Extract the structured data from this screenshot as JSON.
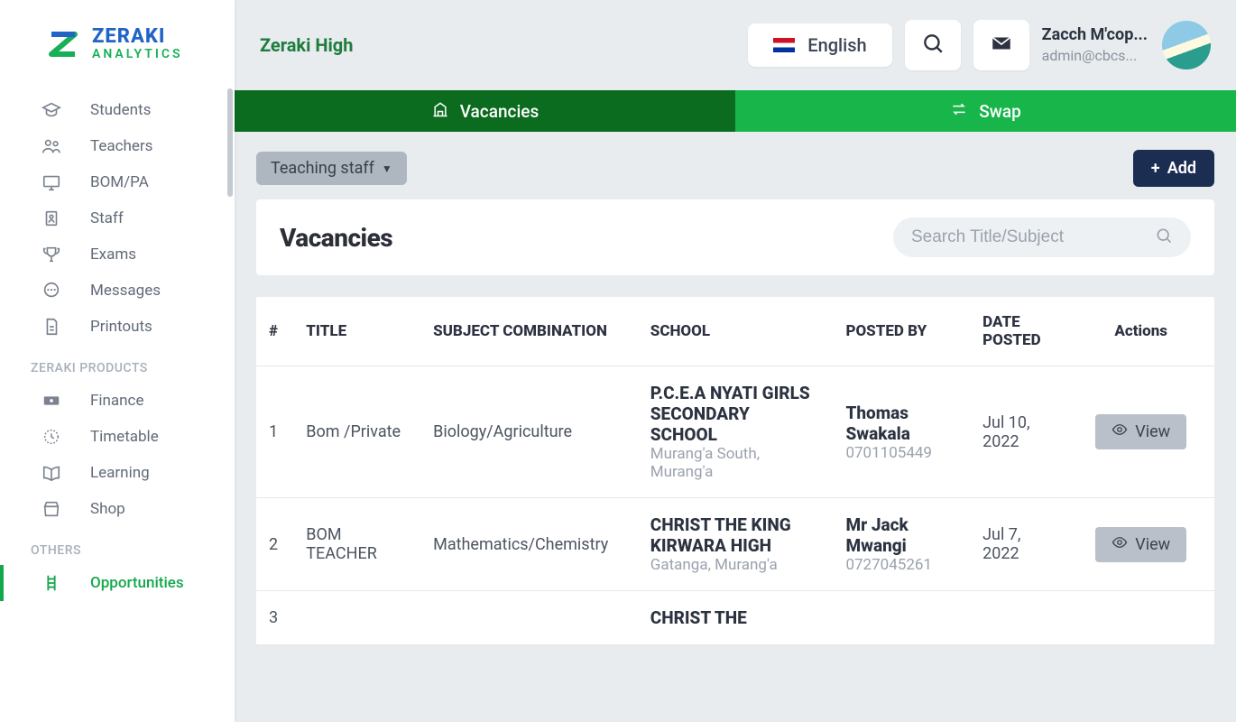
{
  "brand": {
    "name": "ZERAKI",
    "sub": "ANALYTICS"
  },
  "school": "Zeraki High",
  "language": "English",
  "user": {
    "name": "Zacch M'cop...",
    "email": "admin@cbcs..."
  },
  "sidebar": {
    "items": [
      {
        "label": "Students"
      },
      {
        "label": "Teachers"
      },
      {
        "label": "BOM/PA"
      },
      {
        "label": "Staff"
      },
      {
        "label": "Exams"
      },
      {
        "label": "Messages"
      },
      {
        "label": "Printouts"
      }
    ],
    "productsHeading": "ZERAKI PRODUCTS",
    "products": [
      {
        "label": "Finance"
      },
      {
        "label": "Timetable"
      },
      {
        "label": "Learning"
      },
      {
        "label": "Shop"
      }
    ],
    "othersHeading": "OTHERS",
    "others": [
      {
        "label": "Opportunities"
      }
    ]
  },
  "tabs": {
    "vacancies": "Vacancies",
    "swap": "Swap"
  },
  "filter": "Teaching staff",
  "addLabel": "Add",
  "panelTitle": "Vacancies",
  "searchPlaceholder": "Search Title/Subject",
  "columns": {
    "num": "#",
    "title": "TITLE",
    "subject": "SUBJECT COMBINATION",
    "school": "SCHOOL",
    "postedBy": "POSTED BY",
    "datePosted": "DATE POSTED",
    "actions": "Actions"
  },
  "rows": [
    {
      "num": "1",
      "title": "Bom /Private",
      "subject": "Biology/Agriculture",
      "school": "P.C.E.A NYATI GIRLS SECONDARY SCHOOL",
      "schoolSub": "Murang'a South, Murang'a",
      "postedBy": "Thomas Swakala",
      "postedByPhone": "0701105449",
      "date": "Jul 10, 2022",
      "action": "View"
    },
    {
      "num": "2",
      "title": "BOM TEACHER",
      "subject": "Mathematics/Chemistry",
      "school": "CHRIST THE KING KIRWARA HIGH",
      "schoolSub": "Gatanga, Murang'a",
      "postedBy": "Mr Jack Mwangi",
      "postedByPhone": "0727045261",
      "date": "Jul 7, 2022",
      "action": "View"
    },
    {
      "num": "3",
      "title": "",
      "subject": "",
      "school": "CHRIST THE",
      "schoolSub": "",
      "postedBy": "",
      "postedByPhone": "",
      "date": "",
      "action": ""
    }
  ]
}
